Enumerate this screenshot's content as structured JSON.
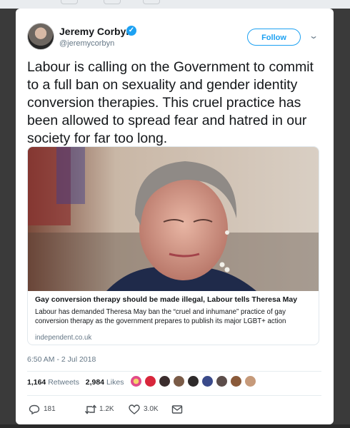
{
  "author": {
    "name": "Jeremy Corbyn",
    "handle": "@jeremycorbyn",
    "verified_glyph": "✓"
  },
  "follow_label": "Follow",
  "menu_icon": "chevron-down-icon",
  "tweet_text": "Labour is calling on the Government to commit to a full ban on sexuality and gender identity conversion therapies. This cruel practice has been allowed to spread fear and hatred in our society for far too long.",
  "card": {
    "title": "Gay conversion therapy should be made illegal, Labour tells Theresa May",
    "description": "Labour has demanded Theresa May ban the “cruel and inhumane” practice of gay conversion therapy as the government prepares to publish its major LGBT+ action",
    "domain": "independent.co.uk"
  },
  "timestamp": "6:50 AM - 2 Jul 2018",
  "stats": {
    "retweets_count": "1,164",
    "retweets_label": "Retweets",
    "likes_count": "2,984",
    "likes_label": "Likes"
  },
  "actions": {
    "replies": "181",
    "retweets": "1.2K",
    "likes": "3.0K"
  },
  "colors": {
    "accent": "#1da1f2",
    "text": "#14171a",
    "muted": "#657786"
  }
}
